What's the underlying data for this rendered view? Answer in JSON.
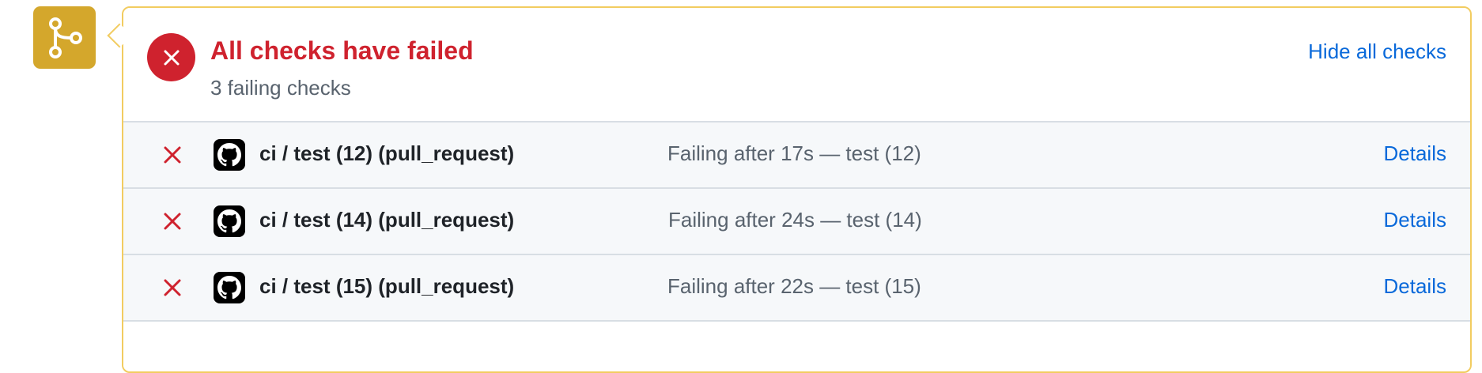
{
  "branch_badge": {
    "icon": "git-branch-icon",
    "color": "#d4a72c"
  },
  "summary": {
    "status_icon": "x-circle-icon",
    "title": "All checks have failed",
    "subtitle": "3 failing checks",
    "toggle_label": "Hide all checks",
    "colors": {
      "fail": "#cf222e",
      "link": "#0969da",
      "border": "#f2cc60"
    }
  },
  "checks": [
    {
      "name": "ci / test (12) (pull_request)",
      "status": "Failing after 17s — test (12)",
      "details_label": "Details",
      "result_icon": "x-icon",
      "app_icon": "github-actions-icon"
    },
    {
      "name": "ci / test (14) (pull_request)",
      "status": "Failing after 24s — test (14)",
      "details_label": "Details",
      "result_icon": "x-icon",
      "app_icon": "github-actions-icon"
    },
    {
      "name": "ci / test (15) (pull_request)",
      "status": "Failing after 22s — test (15)",
      "details_label": "Details",
      "result_icon": "x-icon",
      "app_icon": "github-actions-icon"
    }
  ]
}
